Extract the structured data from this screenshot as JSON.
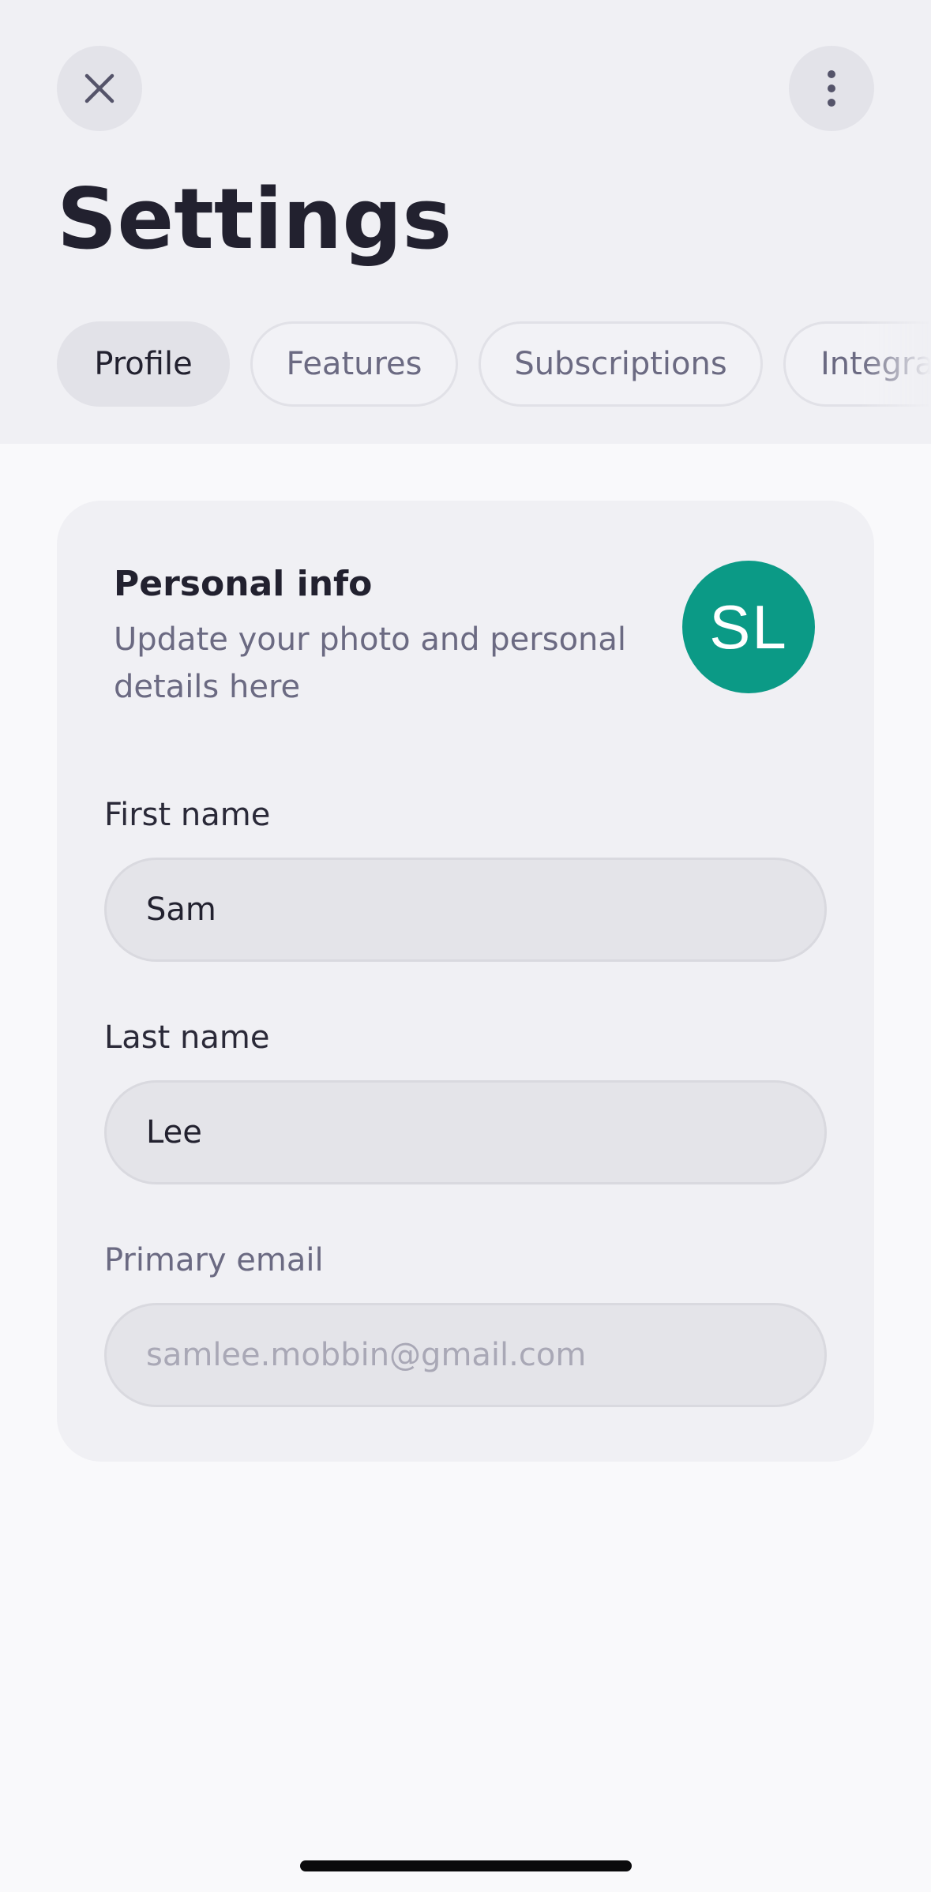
{
  "header": {
    "title": "Settings",
    "close_icon": "close-icon",
    "more_icon": "more-vertical-icon"
  },
  "tabs": [
    {
      "label": "Profile",
      "active": true
    },
    {
      "label": "Features",
      "active": false
    },
    {
      "label": "Subscriptions",
      "active": false
    },
    {
      "label": "Integrations",
      "active": false
    }
  ],
  "personal_info": {
    "title": "Personal info",
    "subtitle": "Update your photo and personal details here",
    "avatar_initials": "SL",
    "avatar_color": "#0b9a86"
  },
  "fields": {
    "first_name": {
      "label": "First name",
      "value": "Sam"
    },
    "last_name": {
      "label": "Last name",
      "value": "Lee"
    },
    "primary_email": {
      "label": "Primary email",
      "value": "samlee.mobbin@gmail.com",
      "disabled": true
    }
  }
}
